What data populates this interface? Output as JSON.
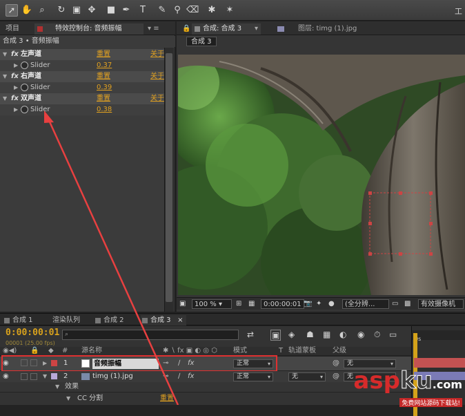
{
  "toolbar": {
    "right_text": "工"
  },
  "left_panel": {
    "tabs": [
      "项目",
      "特效控制台: 音频振幅"
    ],
    "subtitle": "合成 3 • 音频振幅",
    "effects": [
      {
        "name": "左声道",
        "reset": "重置",
        "about": "关于",
        "param": "Slider",
        "value": "0.37"
      },
      {
        "name": "右声道",
        "reset": "重置",
        "about": "关于",
        "param": "Slider",
        "value": "0.39"
      },
      {
        "name": "双声道",
        "reset": "重置",
        "about": "关于",
        "param": "Slider",
        "value": "0.38"
      }
    ]
  },
  "comp_panel": {
    "tab": "合成: 合成 3",
    "layer_tab": "图层: timg (1).jpg",
    "badge": "合成 3",
    "zoom": "100 %",
    "timecode": "0:00:00:01",
    "resolution": "(全分辨...",
    "camera": "有效摄像机"
  },
  "bottom_tabs": [
    "合成 1",
    "渲染队列",
    "合成 2",
    "合成 3"
  ],
  "timeline": {
    "time": "0:00:00:01",
    "fps": "00001 (25.00 fps)",
    "search_placeholder": "",
    "headers": {
      "num": "#",
      "source": "源名称",
      "mode": "模式",
      "t": "T",
      "trkmat": "轨道蒙板",
      "parent": "父级"
    },
    "layers": [
      {
        "num": "1",
        "name": "音频振幅",
        "mode": "正常",
        "parent": "无"
      },
      {
        "num": "2",
        "name": "timg (1).jpg",
        "mode": "正常",
        "trkmat": "无",
        "parent": "无"
      }
    ],
    "effects_label": "效果",
    "cc_label": "CC 分割",
    "cc_reset": "重置",
    "ruler": "0s"
  },
  "watermark": {
    "logo_a": "asp",
    "logo_b": "ku",
    ".com": ".com",
    "sub": "免费网站源码下载站!"
  },
  "colors": {
    "accent_orange": "#e0a020",
    "arrow": "#e84040",
    "highlight_box": "#e03030"
  }
}
